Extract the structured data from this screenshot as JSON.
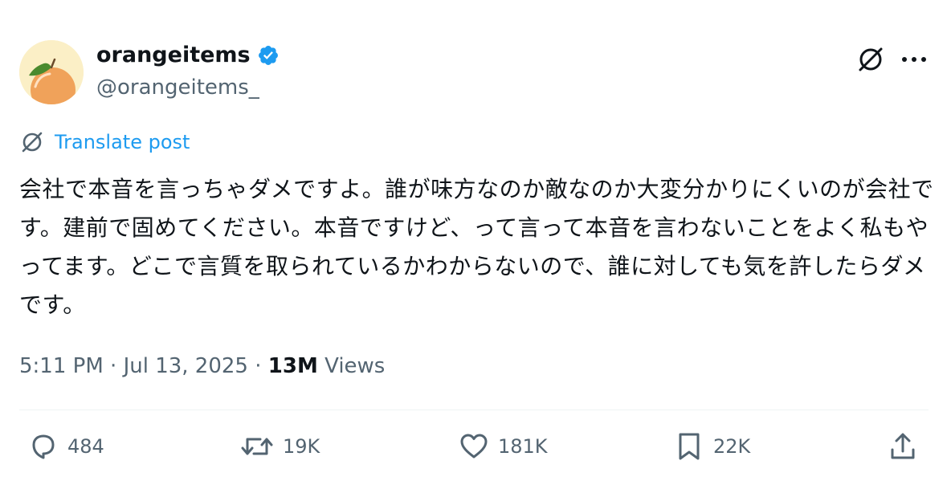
{
  "author": {
    "display_name": "orangeitems",
    "handle": "@orangeitems_",
    "verified": true,
    "verified_color": "#1d9bf0"
  },
  "header_icons": [
    "grok-icon",
    "more-icon"
  ],
  "translate": {
    "label": "Translate post",
    "icon": "translate-icon"
  },
  "post": {
    "text": "会社で本音を言っちゃダメですよ。誰が味方なのか敵なのか大変分かりにくいのが会社です。建前で固めてください。本音ですけど、って言って本音を言わないことをよく私もやってます。どこで言質を取られているかわからないので、誰に対しても気を許したらダメです。"
  },
  "meta": {
    "time": "5:11 PM",
    "date": "Jul 13, 2025",
    "separator": "·",
    "views_count": "13M",
    "views_label": "Views"
  },
  "actions": {
    "replies": "484",
    "reposts": "19K",
    "likes": "181K",
    "bookmarks": "22K"
  },
  "colors": {
    "text_primary": "#0f1419",
    "text_secondary": "#536471",
    "accent": "#1d9bf0",
    "divider": "#eff3f4"
  }
}
